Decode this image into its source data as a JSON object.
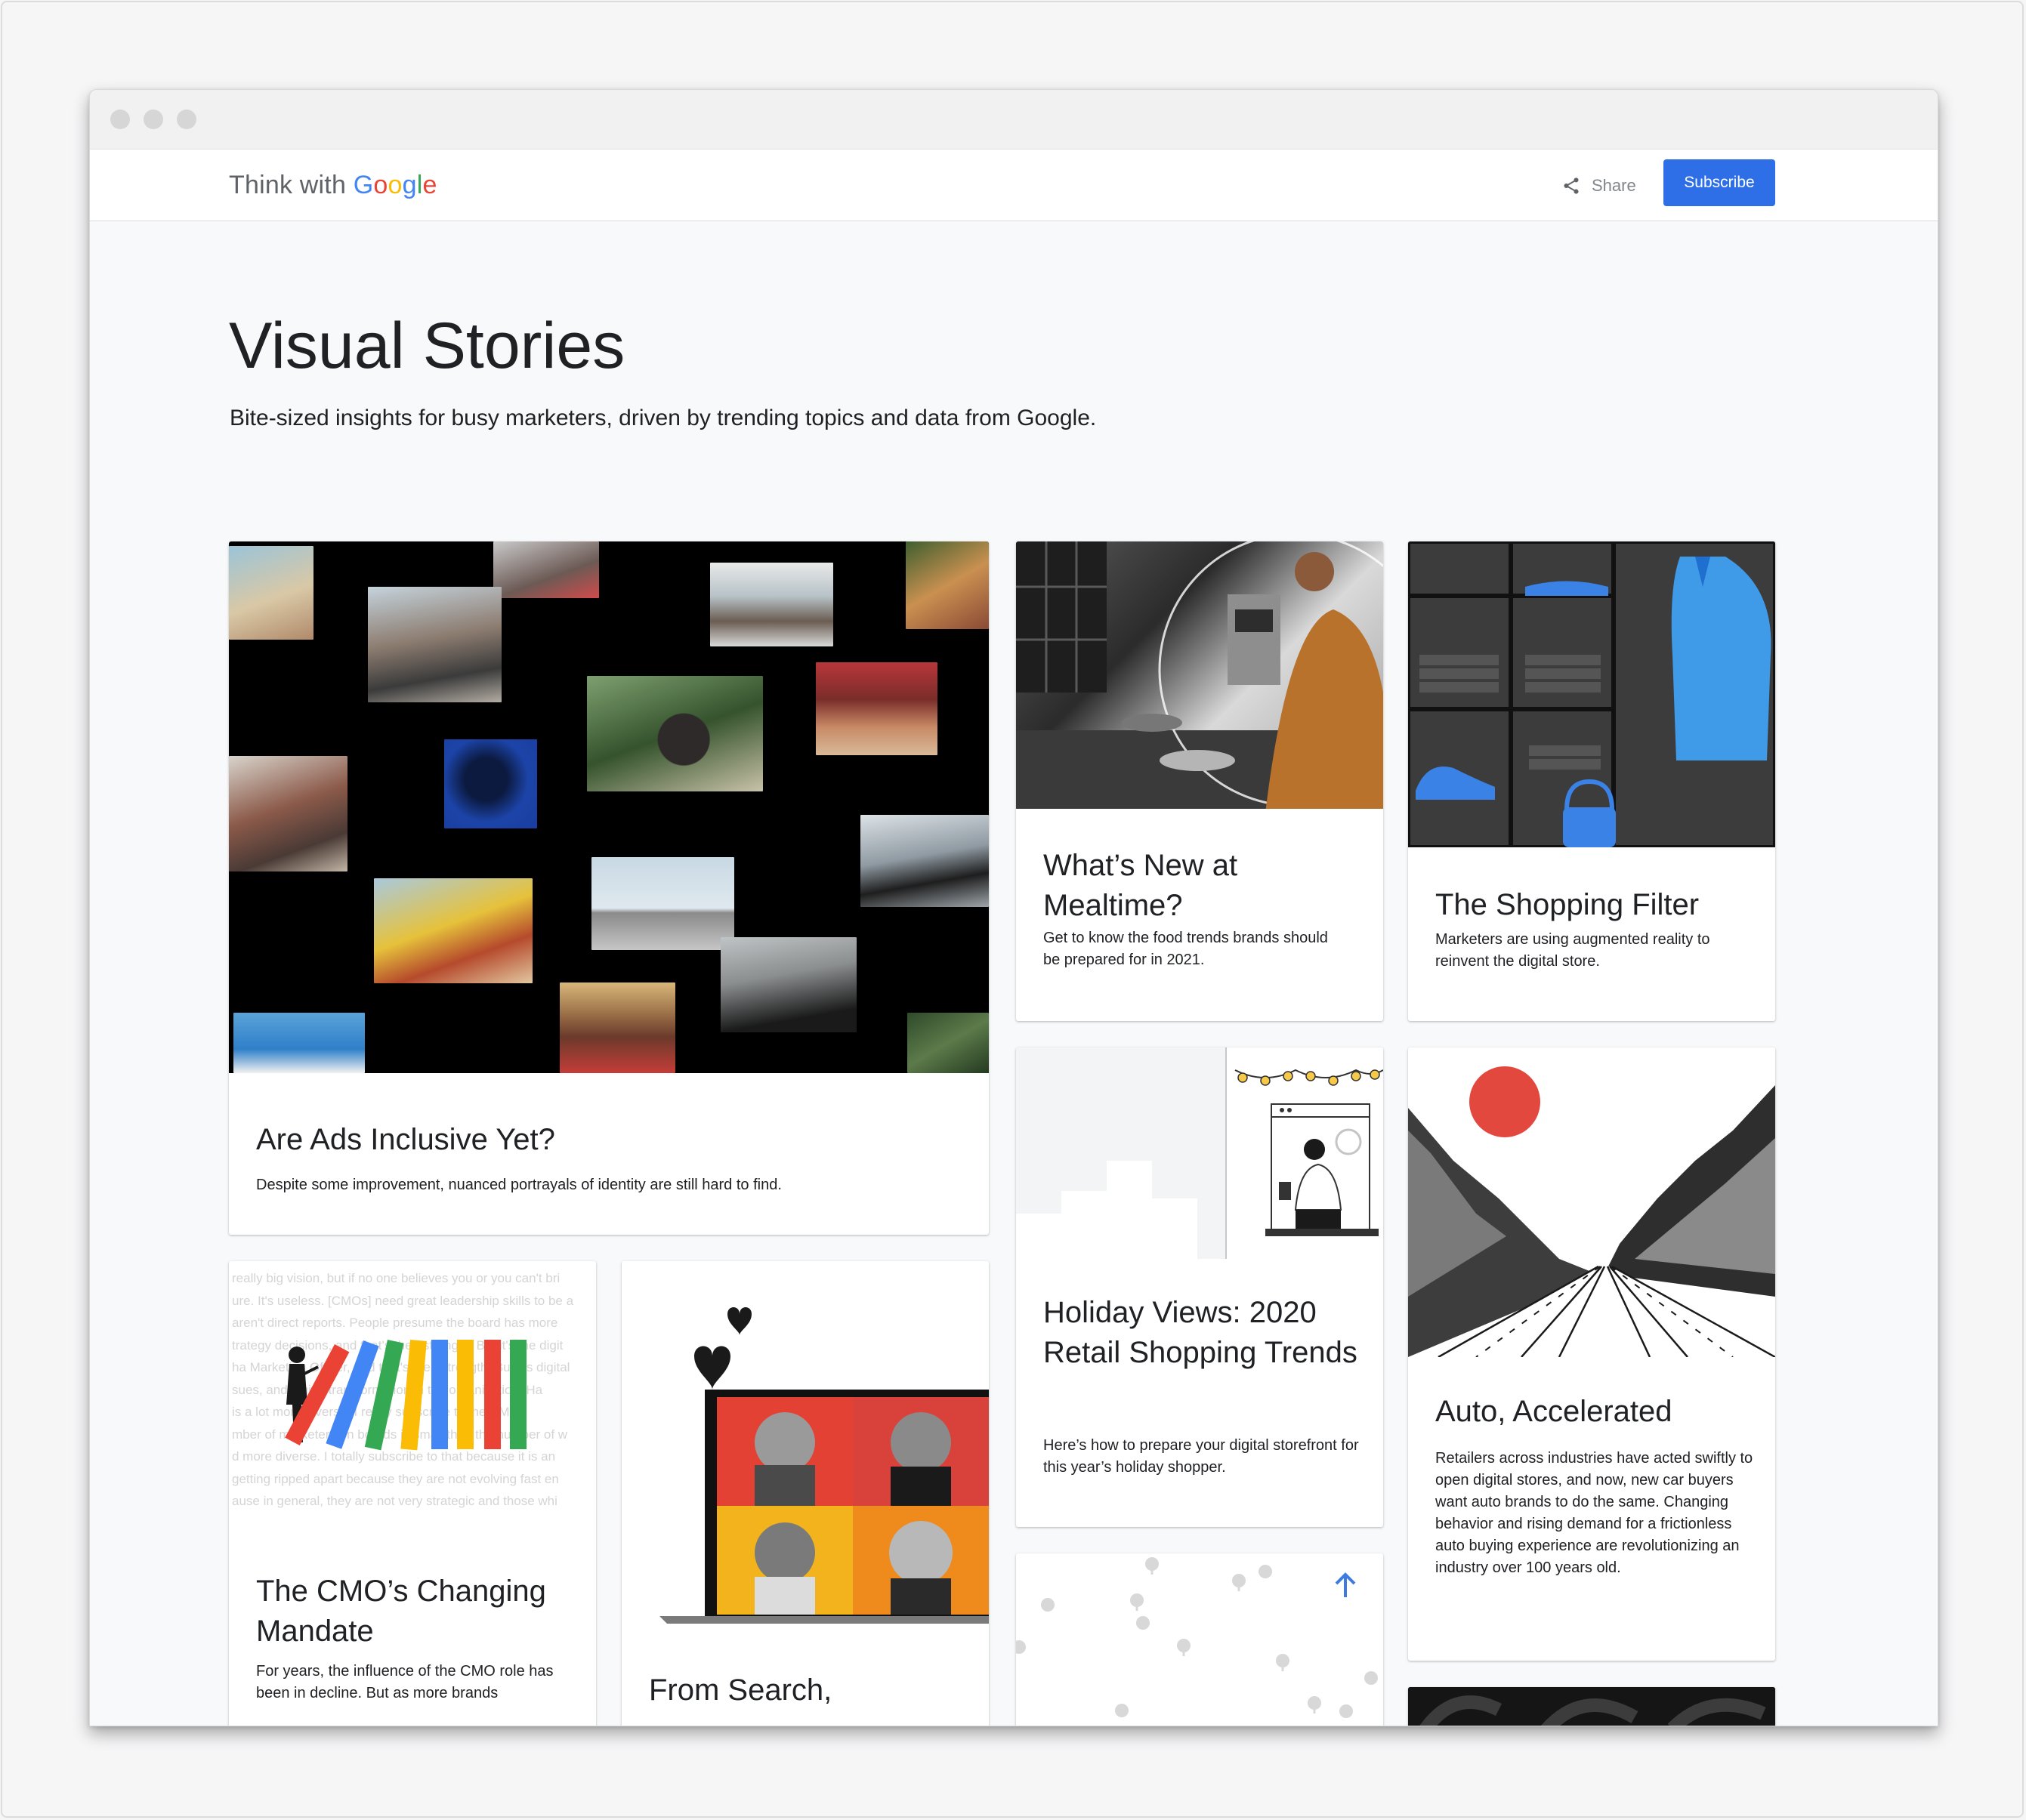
{
  "header": {
    "logo_think": "Think with ",
    "logo_google": [
      "G",
      "o",
      "o",
      "g",
      "l",
      "e"
    ],
    "share_label": "Share",
    "subscribe_label": "Subscribe"
  },
  "page": {
    "title": "Visual Stories",
    "subtitle": "Bite-sized insights for busy marketers, driven by trending topics and data from Google."
  },
  "cards": [
    {
      "title": "Are Ads Inclusive Yet?",
      "desc": "Despite some improvement, nuanced portrayals of identity are still hard to find."
    },
    {
      "title": "What’s New at Mealtime?",
      "desc": "Get to know the food trends brands should be prepared for in 2021."
    },
    {
      "title": "The Shopping Filter",
      "desc": "Marketers are using augmented reality to reinvent the digital store."
    },
    {
      "title": "Holiday Views: 2020 Retail Shopping Trends",
      "desc": "Here’s how to prepare your digital storefront for this year’s holiday shopper."
    },
    {
      "title": "Auto, Accelerated",
      "desc": "Retailers across industries have acted swiftly to open digital stores, and now, new car buyers want auto brands to do the same. Changing behavior and rising demand for a frictionless auto buying experience are revolutionizing an industry over 100 years old."
    },
    {
      "title": "The CMO’s Changing Mandate",
      "desc": "For years, the influence of the CMO role has been in decline. But as more brands"
    },
    {
      "title": "From Search,"
    }
  ],
  "cmo_bg_text": [
    "really big vision, but if no one believes you or you can't bri",
    "ure. It's useless. [CMOs] need great leadership skills to be a",
    "aren't direct reports. People presume the board has more",
    "trategy decisions, and that's their strength. But it's the digit",
    "ha Marketing Officer, and that's their strength. But it's digital",
    "sues, and digital transformation in the organization. Ha",
    "is a lot more diverse. I really subscribe to the CM",
    "mber of marketers on boards is small than the number of w",
    "d more diverse. I totally subscribe to that because it is an",
    "getting ripped apart because they are not evolving fast en",
    "ause in general, they are not very strategic and those whi"
  ],
  "colors": {
    "subscribe": "#2e6fe8",
    "google_blue": "#4285f4",
    "google_red": "#ea4335",
    "google_yellow": "#fbbc05",
    "google_green": "#34a853"
  },
  "icons": [
    "share-icon",
    "arrow-up-icon"
  ]
}
